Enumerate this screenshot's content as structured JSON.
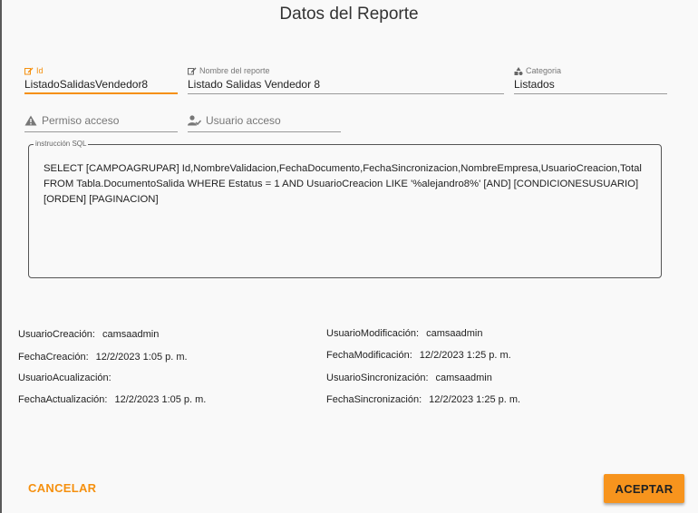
{
  "dialog": {
    "title": "Datos del Reporte"
  },
  "fields": {
    "id": {
      "label": "Id",
      "value": "ListadoSalidasVendedor8",
      "icon": "edit-icon",
      "accent": "#f5900f"
    },
    "nombre": {
      "label": "Nombre del reporte",
      "value": "Listado Salidas Vendedor 8",
      "icon": "edit-icon"
    },
    "categoria": {
      "label": "Categoria",
      "value": "Listados",
      "icon": "shapes-icon"
    },
    "permiso": {
      "placeholder": "Permiso acceso",
      "icon": "warning-icon"
    },
    "usuario": {
      "placeholder": "Usuario acceso",
      "icon": "user-check-icon"
    }
  },
  "sql": {
    "label": "instrucción SQL",
    "text": "SELECT [CAMPOAGRUPAR] Id,NombreValidacion,FechaDocumento,FechaSincronizacion,NombreEmpresa,UsuarioCreacion,Total FROM Tabla.DocumentoSalida WHERE Estatus = 1 AND UsuarioCreacion LIKE '%alejandro8%'  [AND] [CONDICIONESUSUARIO] [ORDEN] [PAGINACION]"
  },
  "audit": {
    "left": [
      {
        "key": "UsuarioCreación:",
        "value": "camsaadmin"
      },
      {
        "key": "FechaCreación:",
        "value": "12/2/2023 1:05 p. m."
      },
      {
        "key": "UsuarioAcualización:",
        "value": ""
      },
      {
        "key": "FechaActualización:",
        "value": "12/2/2023 1:05 p. m."
      }
    ],
    "right": [
      {
        "key": "UsuarioModificación:",
        "value": "camsaadmin"
      },
      {
        "key": "FechaModificación:",
        "value": "12/2/2023 1:25 p. m."
      },
      {
        "key": "UsuarioSincronización:",
        "value": "camsaadmin"
      },
      {
        "key": "FechaSincronización:",
        "value": "12/2/2023 1:25 p. m."
      }
    ]
  },
  "buttons": {
    "cancel": "CANCELAR",
    "accept": "ACEPTAR"
  },
  "colors": {
    "accent": "#f5900f",
    "accept_bg": "#f7941d",
    "background": "#f9f9f9"
  }
}
